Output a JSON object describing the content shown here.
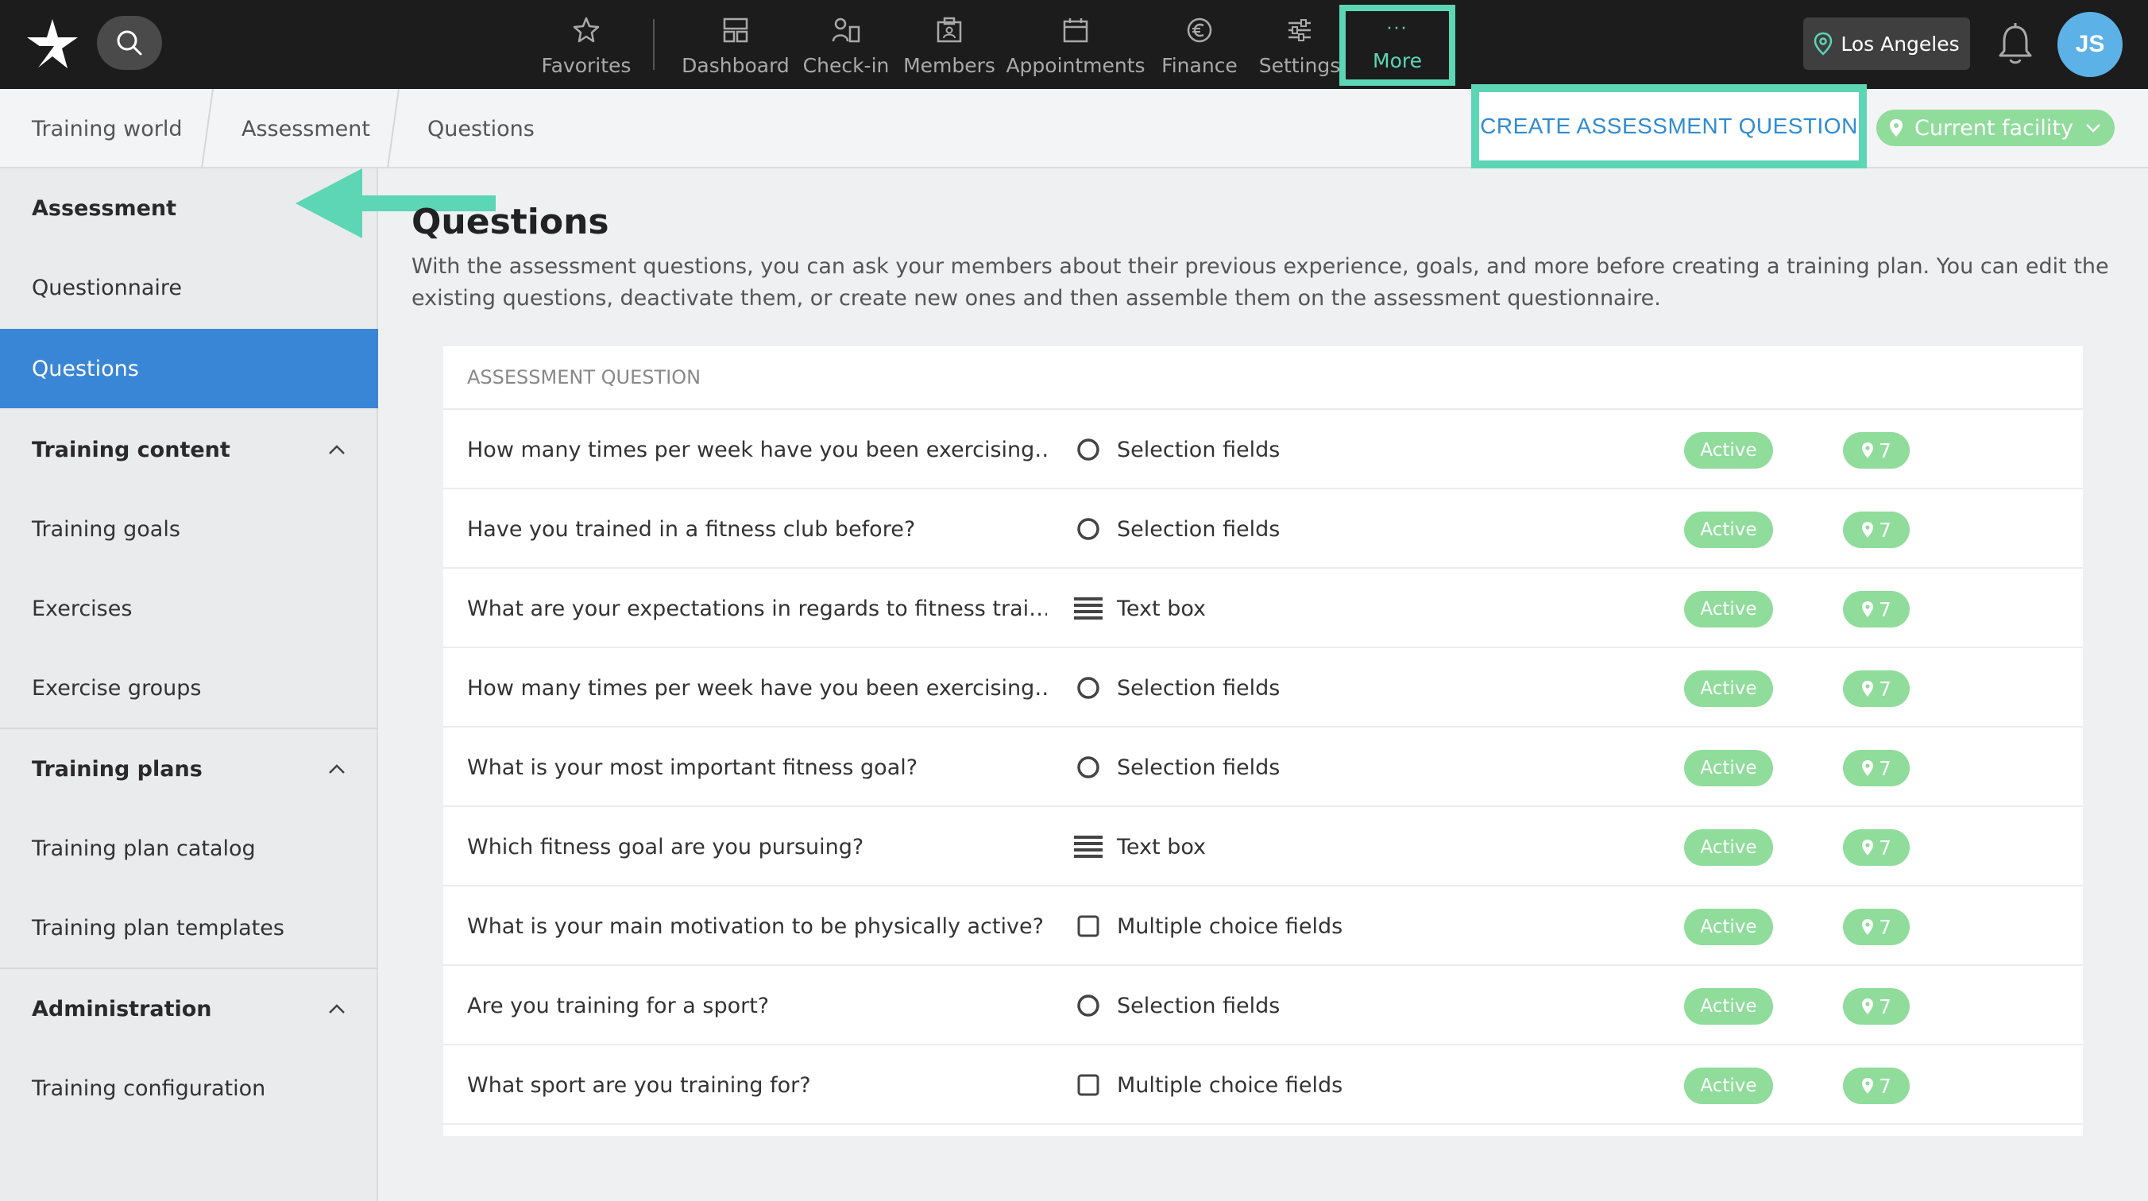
{
  "topbar": {
    "nav": [
      {
        "label": "Favorites",
        "icon": "star-icon"
      },
      {
        "label": "Dashboard",
        "icon": "dashboard-icon"
      },
      {
        "label": "Check-in",
        "icon": "check-in-icon"
      },
      {
        "label": "Members",
        "icon": "members-icon"
      },
      {
        "label": "Appointments",
        "icon": "calendar-icon"
      },
      {
        "label": "Finance",
        "icon": "euro-icon"
      },
      {
        "label": "Settings",
        "icon": "sliders-icon"
      }
    ],
    "more": {
      "label": "More",
      "dots": "···"
    },
    "location": "Los Angeles",
    "avatar_initials": "JS"
  },
  "breadcrumb": [
    "Training world",
    "Assessment",
    "Questions"
  ],
  "actions": {
    "create_label": "CREATE ASSESSMENT QUESTION",
    "facility_label": "Current facility"
  },
  "sidebar": {
    "items": [
      {
        "label": "Assessment",
        "kind": "section"
      },
      {
        "label": "Questionnaire",
        "kind": "item"
      },
      {
        "label": "Questions",
        "kind": "active"
      },
      {
        "label": "Training content",
        "kind": "section-collapsible"
      },
      {
        "label": "Training goals",
        "kind": "item"
      },
      {
        "label": "Exercises",
        "kind": "item"
      },
      {
        "label": "Exercise groups",
        "kind": "item"
      },
      {
        "label": "Training plans",
        "kind": "section-collapsible"
      },
      {
        "label": "Training plan catalog",
        "kind": "item"
      },
      {
        "label": "Training plan templates",
        "kind": "item"
      },
      {
        "label": "Administration",
        "kind": "section-collapsible"
      },
      {
        "label": "Training configuration",
        "kind": "item"
      }
    ]
  },
  "main": {
    "title": "Questions",
    "description": "With the assessment questions, you can ask your members about their previous experience, goals, and more before creating a training plan. You can edit the existing questions, deactivate them, or create new ones and then assemble them on the assessment questionnaire.",
    "table_header": "ASSESSMENT QUESTION",
    "rows": [
      {
        "question": "How many times per week have you been exercising…",
        "type": "Selection fields",
        "type_icon": "radio-icon",
        "status": "Active",
        "locations": "7"
      },
      {
        "question": "Have you trained in a fitness club before?",
        "type": "Selection fields",
        "type_icon": "radio-icon",
        "status": "Active",
        "locations": "7"
      },
      {
        "question": "What are your expectations in regards to fitness trai…",
        "type": "Text box",
        "type_icon": "text-lines-icon",
        "status": "Active",
        "locations": "7"
      },
      {
        "question": "How many times per week have you been exercising…",
        "type": "Selection fields",
        "type_icon": "radio-icon",
        "status": "Active",
        "locations": "7"
      },
      {
        "question": "What is your most important fitness goal?",
        "type": "Selection fields",
        "type_icon": "radio-icon",
        "status": "Active",
        "locations": "7"
      },
      {
        "question": "Which fitness goal are you pursuing?",
        "type": "Text box",
        "type_icon": "text-lines-icon",
        "status": "Active",
        "locations": "7"
      },
      {
        "question": "What is your main motivation to be physically active?",
        "type": "Multiple choice fields",
        "type_icon": "checkbox-icon",
        "status": "Active",
        "locations": "7"
      },
      {
        "question": "Are you training for a sport?",
        "type": "Selection fields",
        "type_icon": "radio-icon",
        "status": "Active",
        "locations": "7"
      },
      {
        "question": "What sport are you training for?",
        "type": "Multiple choice fields",
        "type_icon": "checkbox-icon",
        "status": "Active",
        "locations": "7"
      }
    ]
  },
  "colors": {
    "accent_teal": "#5cd6b4",
    "active_blue": "#3a86d6",
    "status_green": "#8fdc9b",
    "topbar_bg": "#1c1c1c"
  }
}
